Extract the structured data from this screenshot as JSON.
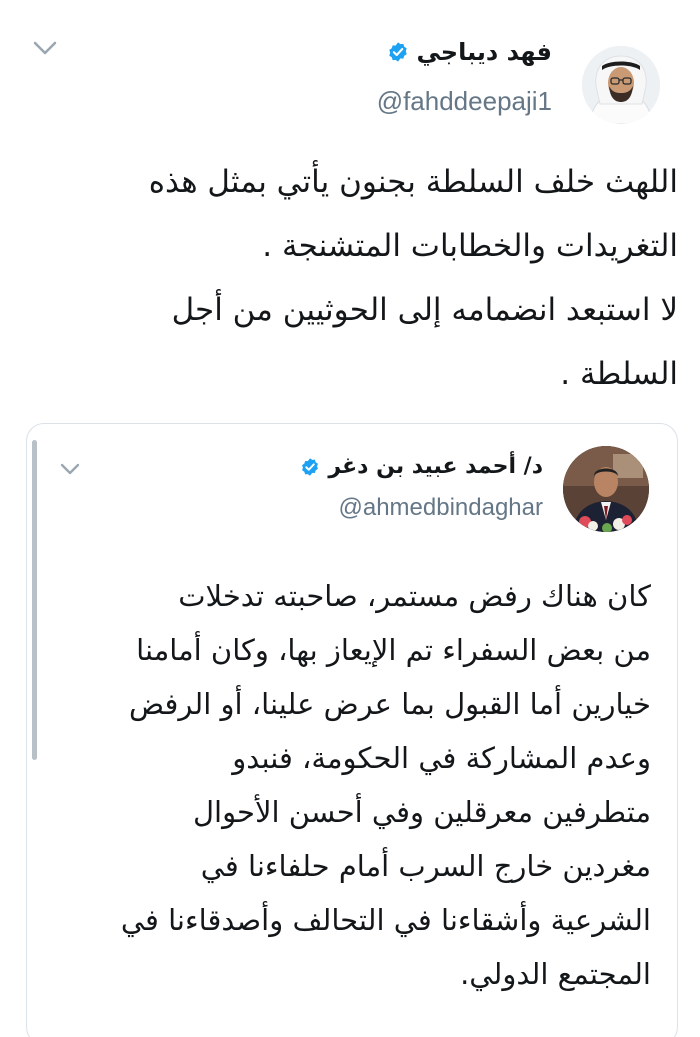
{
  "tweet": {
    "author": {
      "name": "فهد ديباجي",
      "handle": "@fahddeepaji1",
      "verified": true,
      "avatar_icon": "avatar-photo"
    },
    "text_lines": [
      "اللهث خلف السلطة بجنون يأتي بمثل هذه",
      "التغريدات والخطابات المتشنجة .",
      "لا استبعد انضمامه إلى الحوثيين من أجل",
      "السلطة ."
    ],
    "menu_icon": "chevron-down-icon"
  },
  "quoted_tweet": {
    "author": {
      "name": "د/ أحمد عبيد بن دغر",
      "handle": "@ahmedbindaghar",
      "verified": true,
      "avatar_icon": "avatar-photo"
    },
    "text_lines": [
      "كان هناك رفض مستمر، صاحبته تدخلات",
      "من بعض السفراء تم الإيعاز بها، وكان أمامنا",
      "خيارين أما القبول بما عرض علينا، أو الرفض",
      "وعدم المشاركة في الحكومة، فنبدو",
      "متطرفين معرقلين وفي أحسن الأحوال",
      "مغردين خارج السرب أمام حلفاءنا في",
      "الشرعية وأشقاءنا في التحالف وأصدقاءنا في",
      "المجتمع الدولي."
    ],
    "menu_icon": "chevron-down-icon"
  },
  "colors": {
    "text": "#14171a",
    "secondary": "#657786",
    "verified_blue": "#1da1f2",
    "border": "#dbe2e8"
  }
}
